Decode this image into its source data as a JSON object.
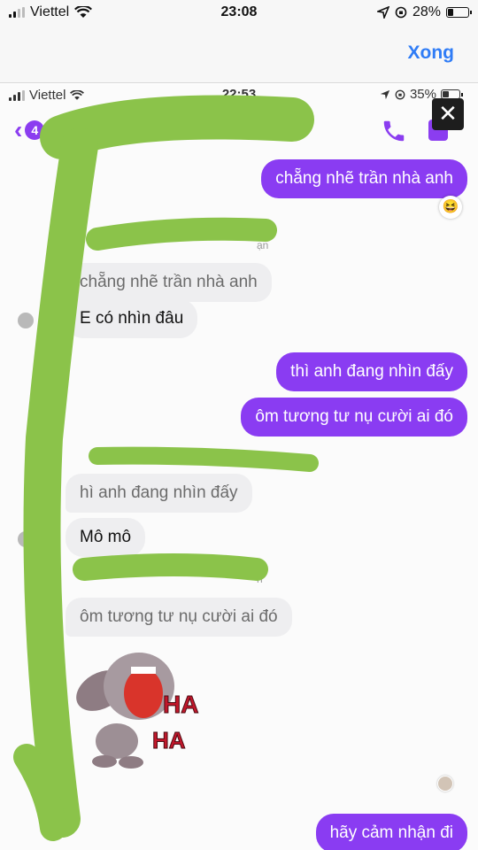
{
  "status_bar": {
    "carrier": "Viettel",
    "time": "23:08",
    "battery": "28%"
  },
  "header": {
    "done_label": "Xong"
  },
  "inner_status_bar": {
    "carrier": "Viettel",
    "time": "22:53",
    "battery": "35%"
  },
  "chat": {
    "back_count": "4",
    "messages": [
      {
        "text": "chẵng nhẽ trần nhà anh"
      },
      {
        "text": "chẵng nhẽ trần nhà anh"
      },
      {
        "text": "E có nhìn đâu"
      },
      {
        "text": "thì anh đang nhìn đấy"
      },
      {
        "text": "ôm tương tư nụ cười ai đó"
      },
      {
        "text": "hì anh đang nhìn đấy"
      },
      {
        "text": "Mô mô"
      },
      {
        "text": "ôm tương tư nụ cười ai đó"
      },
      {
        "text": "hãy cảm nhận đi"
      }
    ],
    "reply_fragments": [
      "ạn",
      "n"
    ],
    "sticker_text": [
      "HA",
      "HA"
    ]
  },
  "colors": {
    "outgoing": "#8a3cf2",
    "accent": "#2f7cf6",
    "scribble": "#8bc34a"
  }
}
